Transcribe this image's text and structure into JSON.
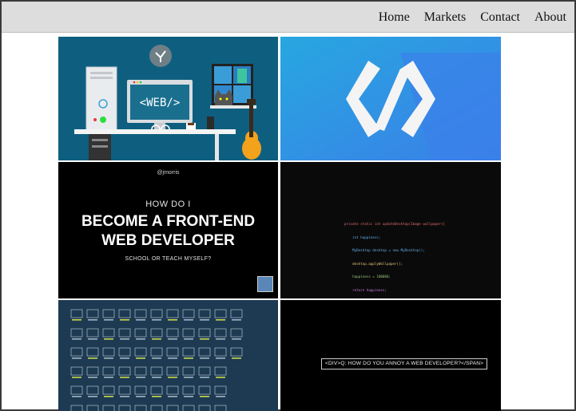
{
  "nav": {
    "items": [
      {
        "label": "Home"
      },
      {
        "label": "Markets"
      },
      {
        "label": "Contact"
      },
      {
        "label": "About"
      }
    ]
  },
  "tiles": {
    "web_desk": {
      "monitor_text": "<WEB/>"
    },
    "code_icon": {
      "icon": "code-brackets-icon"
    },
    "slide": {
      "handle": "@jmorris",
      "pre": "HOW DO I",
      "title_line1": "BECOME A FRONT-END",
      "title_line2": "WEB DEVELOPER",
      "subtitle": "SCHOOL OR TEACH MYSELF?"
    },
    "code_screen": {
      "lines": [
        "private static int updateDesktop(Image wallpaper){",
        "    int happiness;",
        "    MyDesktop desktop = new MyDesktop();",
        "    desktop.applyWallpaper();",
        "    happiness = 100000;",
        "    return happiness;",
        "}"
      ]
    },
    "joke": {
      "text": "<DIV>Q: HOW DO YOU ANNOY A WEB DEVELOPER?</SPAN>"
    }
  },
  "colors": {
    "nav_bg": "#dddddd",
    "tile1_bg": "#0e5f7f",
    "tile2_bg": "#2f9be6",
    "tile5_bg": "#1d3a52"
  }
}
